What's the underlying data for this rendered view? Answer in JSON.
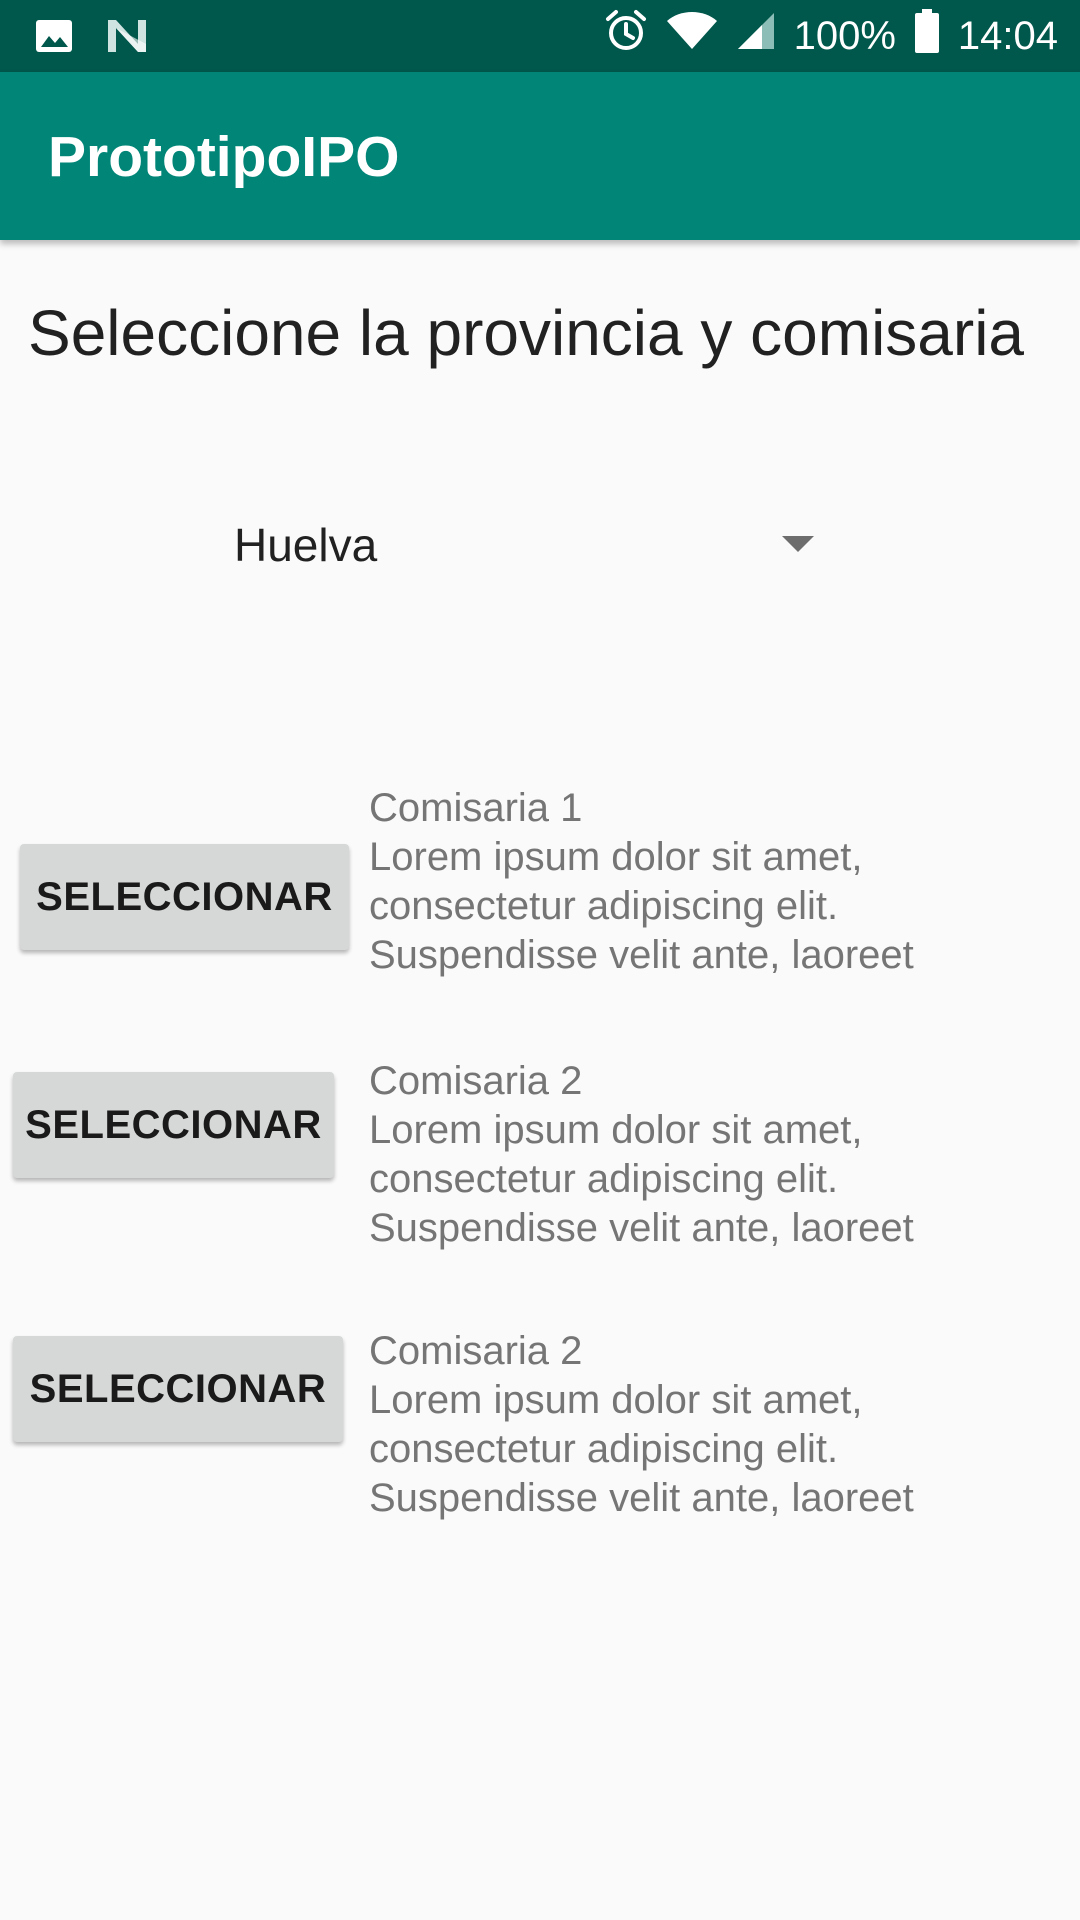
{
  "status_bar": {
    "left_icons": [
      "image-icon",
      "n-logo-icon"
    ],
    "right_icons": [
      "alarm-icon",
      "wifi-icon",
      "signal-icon",
      "battery-icon"
    ],
    "battery": "100%",
    "time": "14:04"
  },
  "app_bar": {
    "title": "PrototipoIPO",
    "color": "#008577",
    "status_color": "#00574b"
  },
  "main": {
    "heading": "Seleccione la provincia y comisaria",
    "province_spinner": {
      "selected": "Huelva"
    },
    "items": [
      {
        "button_label": "SELECCIONAR",
        "name": "Comisaria 1",
        "lines": [
          "Lorem ipsum dolor sit amet,",
          "consectetur adipiscing elit.",
          "Suspendisse velit ante, laoreet"
        ]
      },
      {
        "button_label": "SELECCIONAR",
        "name": "Comisaria 2",
        "lines": [
          "Lorem ipsum dolor sit amet,",
          "consectetur adipiscing elit.",
          "Suspendisse velit ante, laoreet"
        ]
      },
      {
        "button_label": "SELECCIONAR",
        "name": "Comisaria 2",
        "lines": [
          "Lorem ipsum dolor sit amet,",
          "consectetur adipiscing elit.",
          "Suspendisse velit ante, laoreet"
        ]
      }
    ]
  }
}
